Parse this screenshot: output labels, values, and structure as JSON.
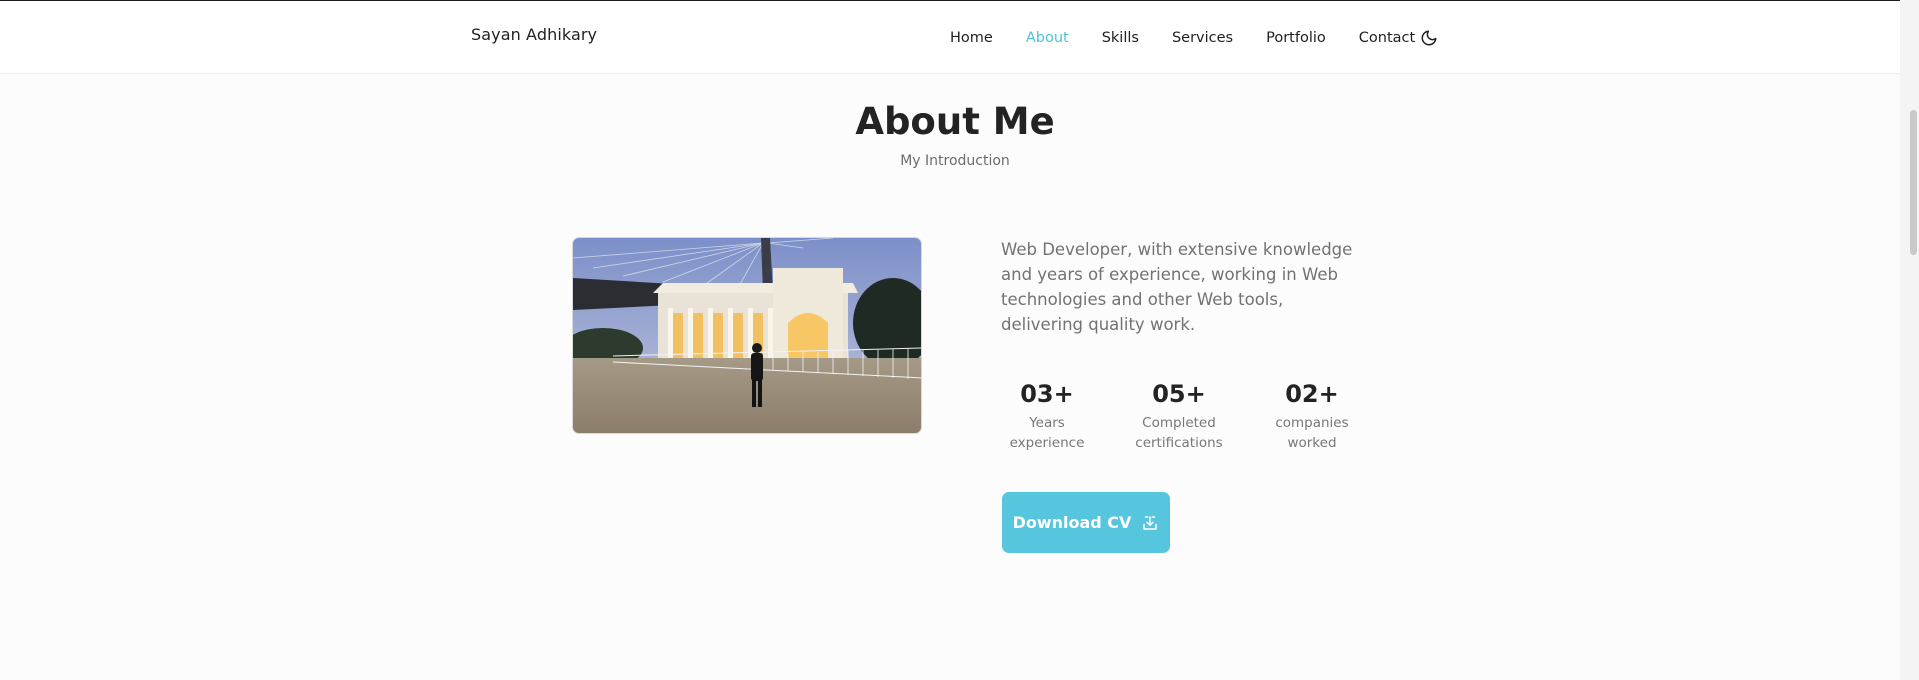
{
  "header": {
    "logo": "Sayan Adhikary",
    "nav": [
      {
        "label": "Home"
      },
      {
        "label": "About"
      },
      {
        "label": "Skills"
      },
      {
        "label": "Services"
      },
      {
        "label": "Portfolio"
      },
      {
        "label": "Contact"
      }
    ],
    "active_nav": "About",
    "theme_toggle_icon": "moon-icon"
  },
  "about": {
    "title": "About Me",
    "subtitle": "My Introduction",
    "description": "Web Developer, with extensive knowledge and years of experience, working in Web technologies and other Web tools, delivering quality work.",
    "stats": [
      {
        "number": "03+",
        "label": "Years experience"
      },
      {
        "number": "05+",
        "label": "Completed certifications"
      },
      {
        "number": "02+",
        "label": "companies worked"
      }
    ],
    "download_label": "Download CV",
    "download_icon": "download-icon"
  },
  "colors": {
    "accent": "#56c6de",
    "nav_active": "#4ec3dd",
    "text": "#1f1f1f",
    "muted": "#727272",
    "background": "#fcfcfd"
  }
}
